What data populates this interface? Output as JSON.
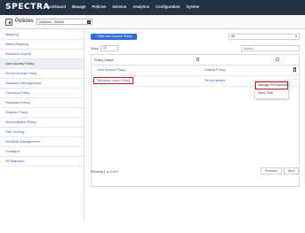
{
  "brand": "SPECTRA",
  "nav": [
    "Dashboard",
    "Manage",
    "Policies",
    "Session",
    "Analytics",
    "Configuration",
    "System"
  ],
  "header": {
    "title": "Policies",
    "instance_value": "Instance - Default",
    "caret": "▾"
  },
  "sidebar": {
    "items": [
      {
        "label": "Mapping",
        "style": "link"
      },
      {
        "label": "Active Mapping",
        "style": "link"
      },
      {
        "label": "Exclusion Access",
        "style": "link"
      },
      {
        "label": "User Access Policy",
        "style": "active"
      },
      {
        "label": "Server Access Policy",
        "style": "link"
      },
      {
        "label": "Password Management",
        "style": "link"
      },
      {
        "label": "Checkout Policy",
        "style": "link"
      },
      {
        "label": "Password Policy",
        "style": "link"
      },
      {
        "label": "Rotation Policy",
        "style": "link"
      },
      {
        "label": "Reconciliation Policy",
        "style": "link"
      },
      {
        "label": "Risk Scoring",
        "style": "link"
      },
      {
        "label": "Workflow Management",
        "style": "link"
      },
      {
        "label": "Configure",
        "style": "link"
      },
      {
        "label": "All Requests",
        "style": "link"
      }
    ]
  },
  "main": {
    "add_button": "+ Add User Access Policy",
    "filter_value": "All",
    "filter_caret": "▾",
    "show_label": "Show",
    "show_value": "10",
    "search_placeholder": "Search...",
    "columns": {
      "name": "Policy Name"
    },
    "rows": [
      {
        "name": "User Access Policy",
        "status": "Default Policy"
      },
      {
        "name": "Windows Users Policy",
        "status": "Set as default"
      }
    ],
    "ellipsis": "...",
    "row_menu": [
      "Manage Permissions",
      "View / Edit"
    ],
    "showing": "Showing 1 to 2 of 2",
    "prev": "Previous",
    "page": "1",
    "next": "Next"
  },
  "colors": {
    "topbar": "#253244",
    "primary_button": "#2e6fd6",
    "link": "#3b66a8",
    "highlight_box": "#c21a1a"
  },
  "icons": [
    "policy-icon",
    "trash-icon",
    "ellipsis-icon",
    "checkbox-icon",
    "caret-down-icon"
  ]
}
